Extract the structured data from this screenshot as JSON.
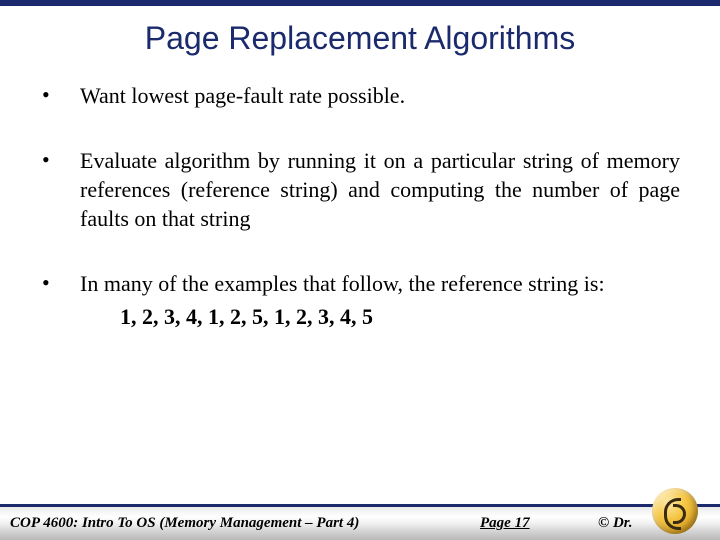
{
  "title": "Page Replacement Algorithms",
  "bullets": [
    {
      "text": "Want lowest page-fault rate possible.",
      "justify": false
    },
    {
      "text": "Evaluate algorithm by running it on a particular string of memory references (reference string) and computing the number of page faults on that string",
      "justify": true
    },
    {
      "text": "In many of the examples that follow, the reference string is:",
      "justify": true,
      "ref": "1, 2, 3, 4, 1, 2, 5, 1, 2, 3, 4, 5"
    }
  ],
  "footer": {
    "course": "COP 4600: Intro To OS  (Memory Management – Part 4)",
    "page": "Page 17",
    "copyright": "© Dr."
  }
}
